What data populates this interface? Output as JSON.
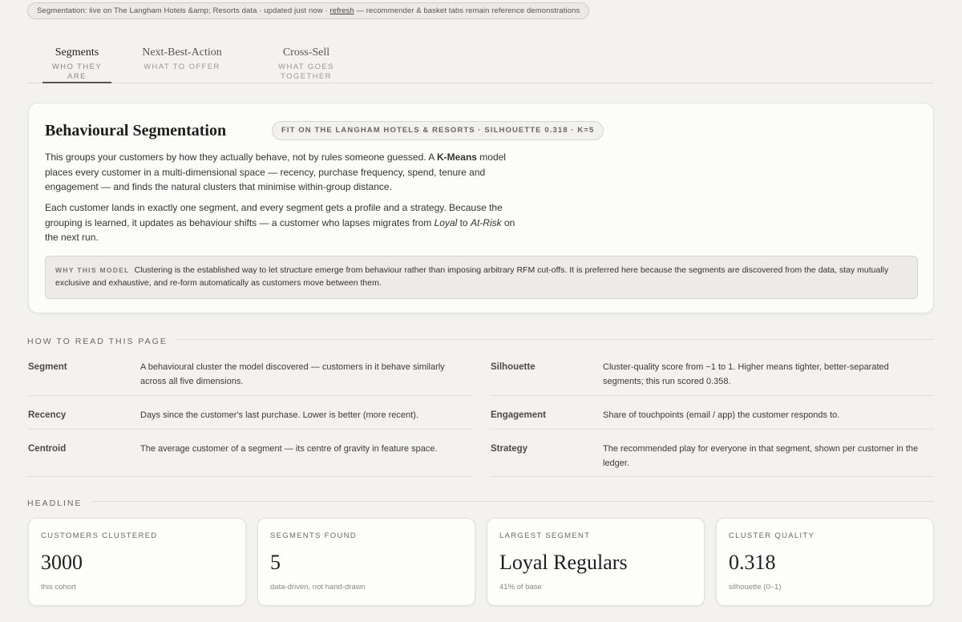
{
  "status": {
    "text_before": "Segmentation: live on The Langham Hotels &amp; Resorts data · updated just now · ",
    "refresh_label": "refresh",
    "text_after": " — recommender & basket tabs remain reference demonstrations"
  },
  "tabs": [
    {
      "title": "Segments",
      "subtitle": "WHO THEY ARE",
      "active": true
    },
    {
      "title": "Next-Best-Action",
      "subtitle": "WHAT TO OFFER",
      "active": false
    },
    {
      "title": "Cross-Sell",
      "subtitle": "WHAT GOES TOGETHER",
      "active": false
    }
  ],
  "intro": {
    "title": "Behavioural Segmentation",
    "badge": "FIT ON THE LANGHAM HOTELS & RESORTS · SILHOUETTE 0.318 · K=5",
    "p1_before": "This groups your customers by how they actually behave, not by rules someone guessed. A ",
    "p1_bold": "K-Means",
    "p1_after": " model places every customer in a multi-dimensional space — recency, purchase frequency, spend, tenure and engagement — and finds the natural clusters that minimise within-group distance.",
    "p2_before": "Each customer lands in exactly one segment, and every segment gets a profile and a strategy. Because the grouping is learned, it updates as behaviour shifts — a customer who lapses migrates from ",
    "p2_em1": "Loyal",
    "p2_mid": " to ",
    "p2_em2": "At-Risk",
    "p2_after": " on the next run.",
    "why_label": "WHY THIS MODEL",
    "why_text": "Clustering is the established way to let structure emerge from behaviour rather than imposing arbitrary RFM cut-offs. It is preferred here because the segments are discovered from the data, stay mutually exclusive and exhaustive, and re-form automatically as customers move between them."
  },
  "how_to_read": {
    "heading": "HOW TO READ THIS PAGE",
    "terms": [
      {
        "term": "Segment",
        "definition": "A behavioural cluster the model discovered — customers in it behave similarly across all five dimensions."
      },
      {
        "term": "Silhouette",
        "definition": "Cluster-quality score from −1 to 1. Higher means tighter, better-separated segments; this run scored 0.358."
      },
      {
        "term": "Recency",
        "definition": "Days since the customer's last purchase. Lower is better (more recent)."
      },
      {
        "term": "Engagement",
        "definition": "Share of touchpoints (email / app) the customer responds to."
      },
      {
        "term": "Centroid",
        "definition": "The average customer of a segment — its centre of gravity in feature space."
      },
      {
        "term": "Strategy",
        "definition": "The recommended play for everyone in that segment, shown per customer in the ledger."
      }
    ]
  },
  "headline": {
    "heading": "HEADLINE",
    "metrics": [
      {
        "label": "CUSTOMERS CLUSTERED",
        "value": "3000",
        "note": "this cohort"
      },
      {
        "label": "SEGMENTS FOUND",
        "value": "5",
        "note": "data-driven, not hand-drawn"
      },
      {
        "label": "LARGEST SEGMENT",
        "value": "Loyal Regulars",
        "note": "41% of base"
      },
      {
        "label": "CLUSTER QUALITY",
        "value": "0.318",
        "note": "silhouette (0–1)"
      }
    ]
  }
}
